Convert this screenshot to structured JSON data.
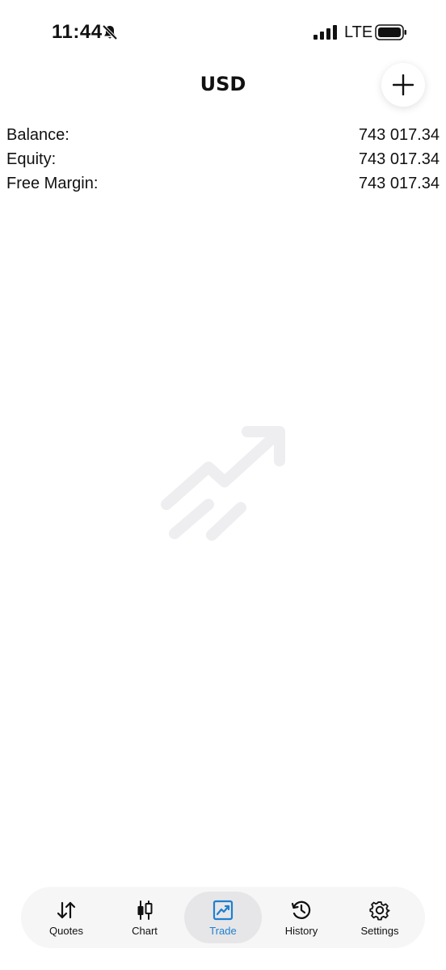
{
  "status_bar": {
    "time": "11:44",
    "network": "LTE"
  },
  "header": {
    "title": "USD"
  },
  "summary": [
    {
      "label": "Balance:",
      "value": "743 017.34"
    },
    {
      "label": "Equity:",
      "value": "743 017.34"
    },
    {
      "label": "Free Margin:",
      "value": "743 017.34"
    }
  ],
  "tabs": [
    {
      "label": "Quotes",
      "icon": "quotes-icon",
      "active": false
    },
    {
      "label": "Chart",
      "icon": "chart-icon",
      "active": false
    },
    {
      "label": "Trade",
      "icon": "trade-icon",
      "active": true
    },
    {
      "label": "History",
      "icon": "history-icon",
      "active": false
    },
    {
      "label": "Settings",
      "icon": "settings-icon",
      "active": false
    }
  ],
  "colors": {
    "accent": "#1f7fd0",
    "illustration": "#eeeef0"
  }
}
